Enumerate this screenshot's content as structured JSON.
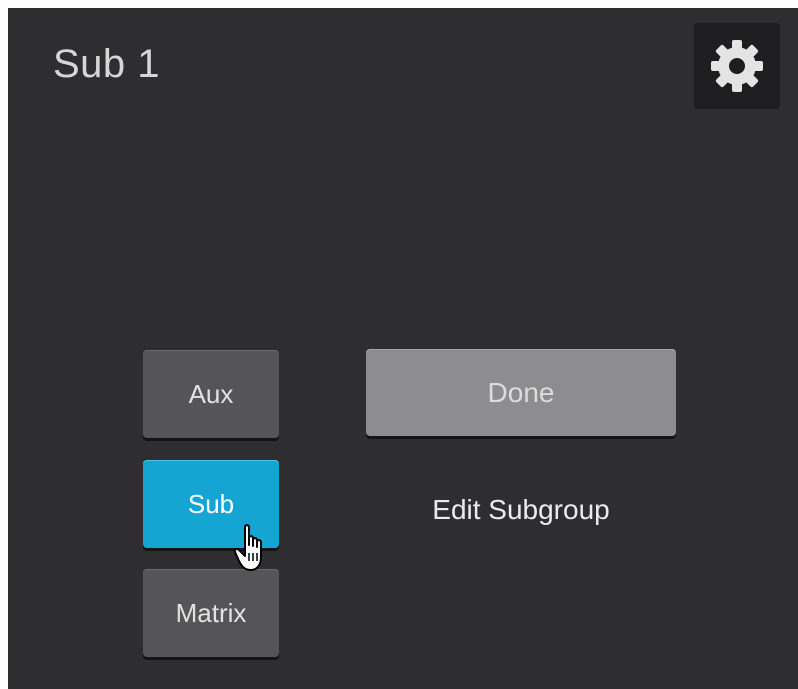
{
  "header": {
    "title": "Sub 1",
    "settings_icon": "gear-icon"
  },
  "mode_buttons": [
    {
      "label": "Aux",
      "active": false
    },
    {
      "label": "Sub",
      "active": true
    },
    {
      "label": "Matrix",
      "active": false
    }
  ],
  "actions": {
    "done_label": "Done",
    "caption": "Edit Subgroup"
  },
  "colors": {
    "panel_bg": "#2e2e30",
    "active_accent": "#14a5d3",
    "button_bg": "#555557",
    "done_bg": "#8d8d8f"
  },
  "cursor_icon": "hand-pointer-icon"
}
